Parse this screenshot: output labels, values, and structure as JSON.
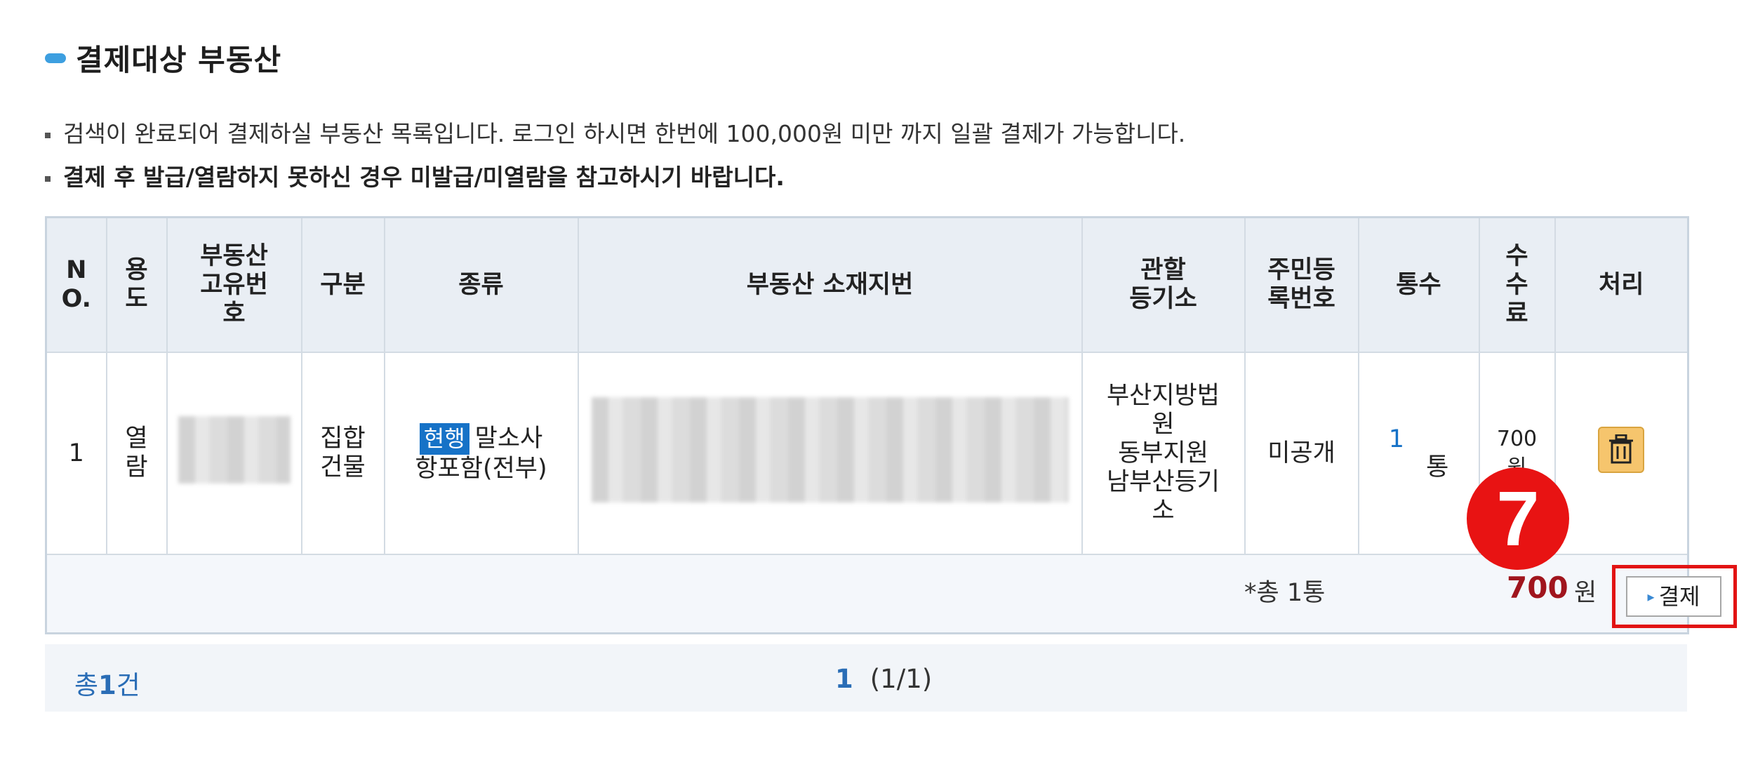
{
  "section_title": "결제대상 부동산",
  "notices": [
    "검색이 완료되어 결제하실 부동산 목록입니다. 로그인 하시면 한번에 100,000원 미만 까지 일괄 결제가 가능합니다.",
    "결제 후 발급/열람하지 못하신 경우 미발급/미열람을 참고하시기 바랍니다."
  ],
  "table": {
    "headers": [
      "N\nO.",
      "용\n도",
      "부동산\n고유번\n호",
      "구분",
      "종류",
      "부동산 소재지번",
      "관할\n등기소",
      "주민등\n록번호",
      "통수",
      "수\n수\n료",
      "처리"
    ],
    "rows": [
      {
        "no": "1",
        "usage": "열\n람",
        "unique_no": "",
        "category": "집합\n건물",
        "type_badge": "현행",
        "type_text": "말소사\n항포함(전부)",
        "address": "",
        "registry": "부산지방법\n원\n동부지원\n남부산등기\n소",
        "resident_no": "미공개",
        "copies": "1",
        "copies_unit": "통",
        "fee": "700\n원",
        "action_icon": "trash-icon"
      }
    ]
  },
  "summary": {
    "total_count": "*총 1통",
    "total_amount": "700",
    "total_unit": "원",
    "pay_label": "결제"
  },
  "step_marker": "7",
  "pager": {
    "total_prefix": "총",
    "total_num": "1",
    "total_suffix": "건",
    "current_page": "1",
    "page_info": "(1/1)"
  },
  "colors": {
    "accent_blue": "#1672c7",
    "amount_red": "#a0151d",
    "highlight_red": "#e21313",
    "trash_yellow": "#f6c56d"
  }
}
